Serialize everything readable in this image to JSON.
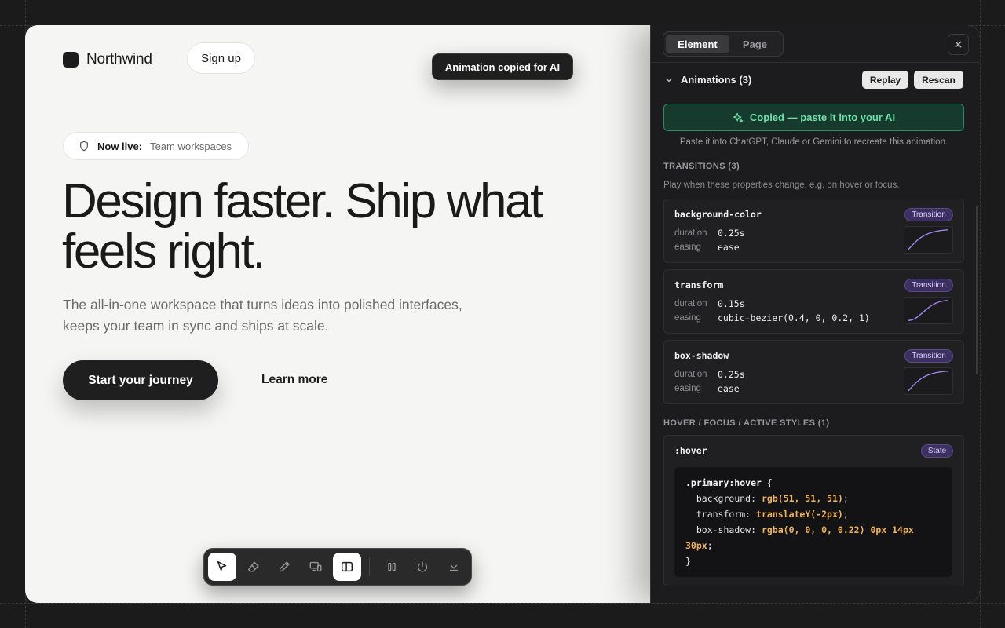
{
  "site": {
    "brand": "Northwind",
    "signup": "Sign up",
    "toast": "Animation copied for AI",
    "live_key": "Now live:",
    "live_value": "Team workspaces",
    "hero_title": "Design faster. Ship what feels right.",
    "hero_sub": "The all-in-one workspace that turns ideas into polished interfaces, keeps your team in sync and ships at scale.",
    "cta": "Start your journey",
    "learn_more": "Learn more"
  },
  "toolbar": {
    "tools": [
      "select-icon",
      "eraser-icon",
      "pencil-icon",
      "devices-icon",
      "sidebar-panel-icon",
      "pause-icon",
      "power-icon",
      "collapse-icon"
    ],
    "active": [
      "select-icon",
      "sidebar-panel-icon"
    ]
  },
  "inspector": {
    "tabs": [
      "Element",
      "Page"
    ],
    "active_tab": "Element",
    "animations_heading": "Animations (3)",
    "replay": "Replay",
    "rescan": "Rescan",
    "copied": "Copied — paste it into your AI",
    "hint": "Paste it into ChatGPT, Claude or Gemini to recreate this animation.",
    "transitions_title": "TRANSITIONS (3)",
    "transitions_desc": "Play when these properties change, e.g. on hover or focus.",
    "duration_label": "duration",
    "easing_label": "easing",
    "transitions": [
      {
        "property": "background-color",
        "badge": "Transition",
        "duration": "0.25s",
        "easing": "ease"
      },
      {
        "property": "transform",
        "badge": "Transition",
        "duration": "0.15s",
        "easing": "cubic-bezier(0.4, 0, 0.2, 1)"
      },
      {
        "property": "box-shadow",
        "badge": "Transition",
        "duration": "0.25s",
        "easing": "ease"
      }
    ],
    "states_title": "HOVER / FOCUS / ACTIVE STYLES (1)",
    "state": {
      "selector_label": ":hover",
      "badge": "State",
      "rule_selector": ".primary:hover",
      "declarations": [
        {
          "prop": "background",
          "value": "rgb(51, 51, 51)"
        },
        {
          "prop": "transform",
          "value": "translateY(-2px)"
        },
        {
          "prop": "box-shadow",
          "value": "rgba(0, 0, 0, 0.22) 0px 14px 30px"
        }
      ]
    }
  },
  "colors": {
    "accent_green": "#6ee0a8",
    "badge_purple": "#3b3060",
    "code_value": "#f0b35a"
  }
}
